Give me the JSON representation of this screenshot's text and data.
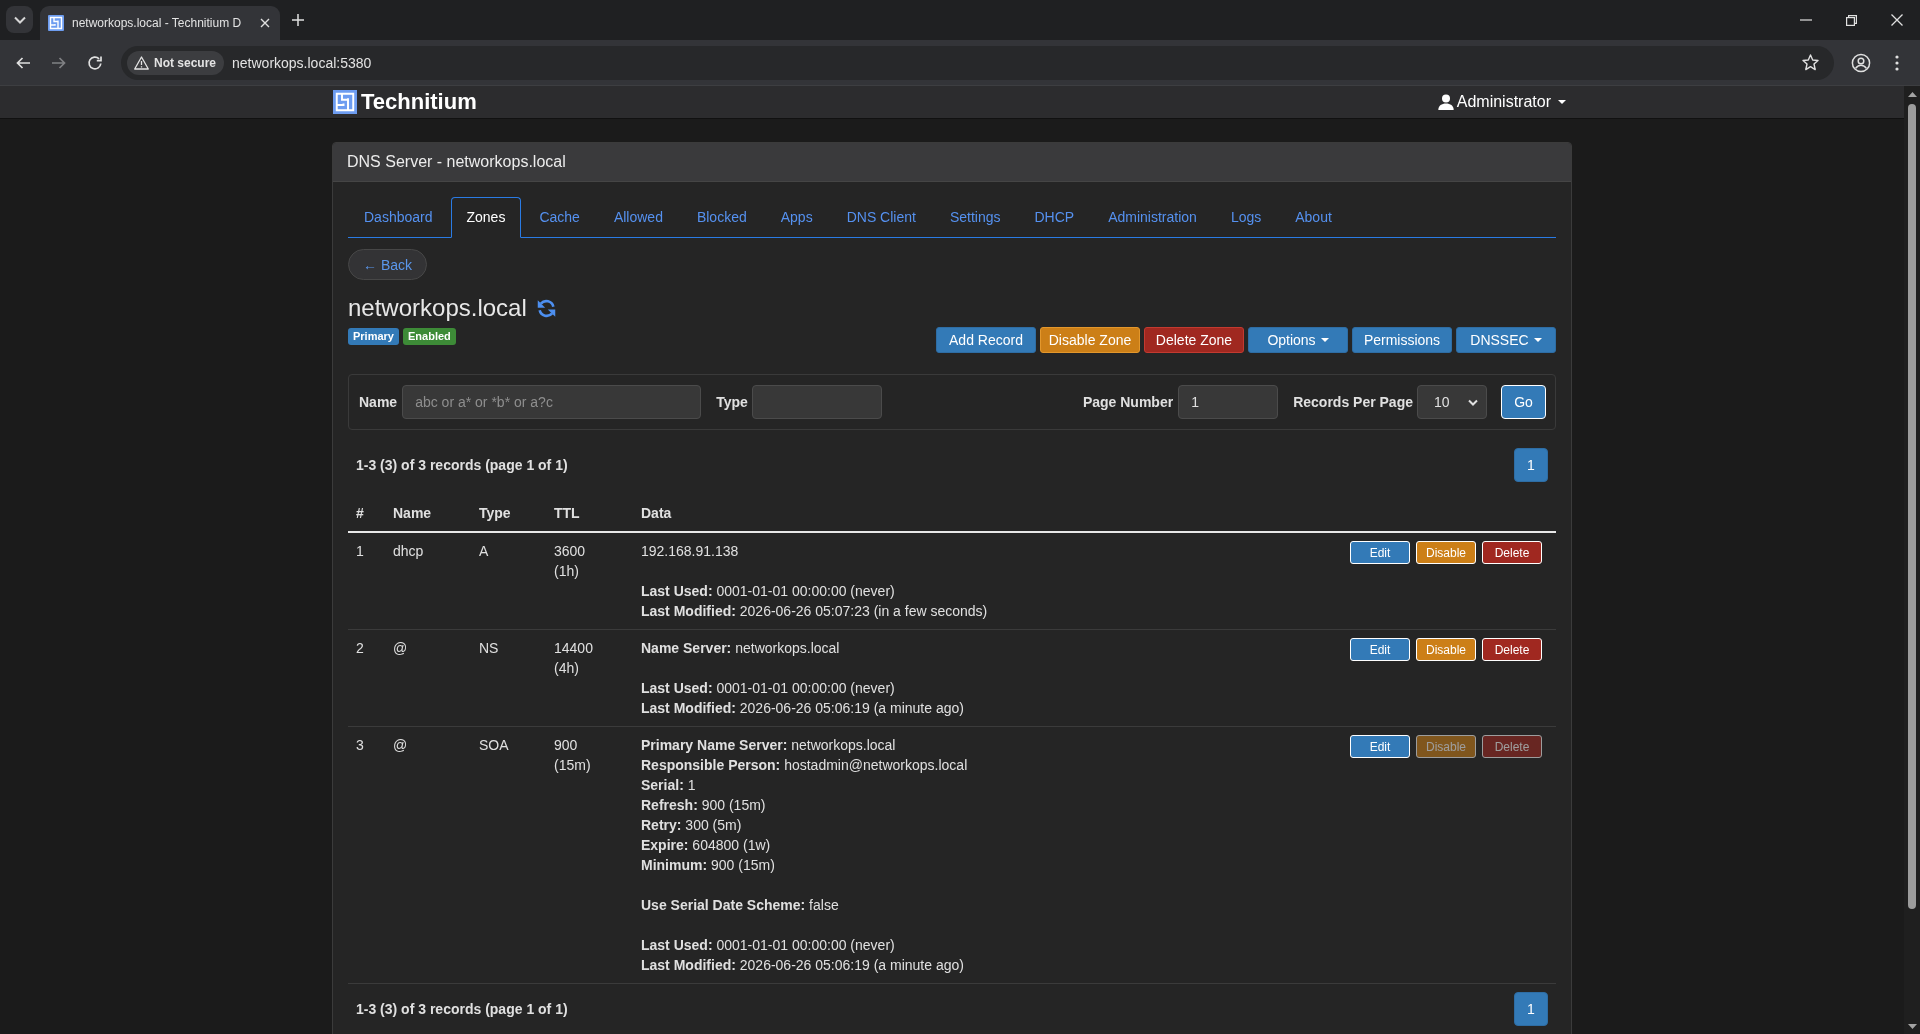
{
  "browser": {
    "tab_title": "networkops.local - Technitium D",
    "forward_disabled": true,
    "security_label": "Not secure",
    "url": "networkops.local:5380"
  },
  "navbar": {
    "brand": "Technitium",
    "user": "Administrator"
  },
  "panel": {
    "title": "DNS Server - networkops.local"
  },
  "tabs": [
    {
      "label": "Dashboard",
      "selected": false
    },
    {
      "label": "Zones",
      "selected": true
    },
    {
      "label": "Cache",
      "selected": false
    },
    {
      "label": "Allowed",
      "selected": false
    },
    {
      "label": "Blocked",
      "selected": false
    },
    {
      "label": "Apps",
      "selected": false
    },
    {
      "label": "DNS Client",
      "selected": false
    },
    {
      "label": "Settings",
      "selected": false
    },
    {
      "label": "DHCP",
      "selected": false
    },
    {
      "label": "Administration",
      "selected": false
    },
    {
      "label": "Logs",
      "selected": false
    },
    {
      "label": "About",
      "selected": false
    }
  ],
  "back_button": "← Back",
  "zone": {
    "name": "networkops.local",
    "badges": [
      {
        "label": "Primary",
        "color": "#337ab7"
      },
      {
        "label": "Enabled",
        "color": "#3d8b37"
      }
    ]
  },
  "zone_actions": [
    {
      "label": "Add Record",
      "kind": "primary",
      "dropdown": false
    },
    {
      "label": "Disable Zone",
      "kind": "warning",
      "dropdown": false
    },
    {
      "label": "Delete Zone",
      "kind": "danger",
      "dropdown": false
    },
    {
      "label": "Options",
      "kind": "primary",
      "dropdown": true
    },
    {
      "label": "Permissions",
      "kind": "primary",
      "dropdown": false
    },
    {
      "label": "DNSSEC",
      "kind": "primary",
      "dropdown": true
    }
  ],
  "filter": {
    "name": {
      "label": "Name",
      "placeholder": "abc or a* or *b* or a?c"
    },
    "type": {
      "label": "Type"
    },
    "page_number": {
      "label": "Page Number",
      "value": "1"
    },
    "records_per_page": {
      "label": "Records Per Page",
      "value": "10"
    },
    "go_button": "Go"
  },
  "pager_top": {
    "summary": "1-3 (3) of 3 records (page 1 of 1)",
    "pages": [
      {
        "label": "1",
        "selected": true
      }
    ]
  },
  "table": {
    "columns": [
      "#",
      "Name",
      "Type",
      "TTL",
      "Data"
    ],
    "rows": [
      {
        "index": "1",
        "name": "dhcp",
        "type": "A",
        "ttl": "3600",
        "ttl_duration": "(1h)",
        "data": [
          [
            "192.168.91.138"
          ],
          [
            "**Last Used:** 0001-01-01 00:00:00 (never)",
            "**Last Modified:** 2026-06-26 05:07:23 (in a few seconds)"
          ]
        ],
        "actions": [
          {
            "label": "Edit",
            "kind": "primary",
            "disabled": false
          },
          {
            "label": "Disable",
            "kind": "warning",
            "disabled": false
          },
          {
            "label": "Delete",
            "kind": "danger",
            "disabled": false
          }
        ]
      },
      {
        "index": "2",
        "name": "@",
        "type": "NS",
        "ttl": "14400",
        "ttl_duration": "(4h)",
        "data": [
          [
            "**Name Server:** networkops.local"
          ],
          [
            "**Last Used:** 0001-01-01 00:00:00 (never)",
            "**Last Modified:** 2026-06-26 05:06:19 (a minute ago)"
          ]
        ],
        "actions": [
          {
            "label": "Edit",
            "kind": "primary",
            "disabled": false
          },
          {
            "label": "Disable",
            "kind": "warning",
            "disabled": false
          },
          {
            "label": "Delete",
            "kind": "danger",
            "disabled": false
          }
        ]
      },
      {
        "index": "3",
        "name": "@",
        "type": "SOA",
        "ttl": "900",
        "ttl_duration": "(15m)",
        "data": [
          [
            "**Primary Name Server:** networkops.local",
            "**Responsible Person:** hostadmin@networkops.local",
            "**Serial:** 1",
            "**Refresh:** 900 (15m)",
            "**Retry:** 300 (5m)",
            "**Expire:** 604800 (1w)",
            "**Minimum:** 900 (15m)"
          ],
          [
            "**Use Serial Date Scheme:** false"
          ],
          [
            "**Last Used:** 0001-01-01 00:00:00 (never)",
            "**Last Modified:** 2026-06-26 05:06:19 (a minute ago)"
          ]
        ],
        "actions": [
          {
            "label": "Edit",
            "kind": "primary",
            "disabled": false
          },
          {
            "label": "Disable",
            "kind": "warning",
            "disabled": true
          },
          {
            "label": "Delete",
            "kind": "danger",
            "disabled": true
          }
        ]
      }
    ]
  },
  "pager_bottom": {
    "summary": "1-3 (3) of 3 records (page 1 of 1)",
    "pages": [
      {
        "label": "1",
        "selected": true
      }
    ]
  }
}
